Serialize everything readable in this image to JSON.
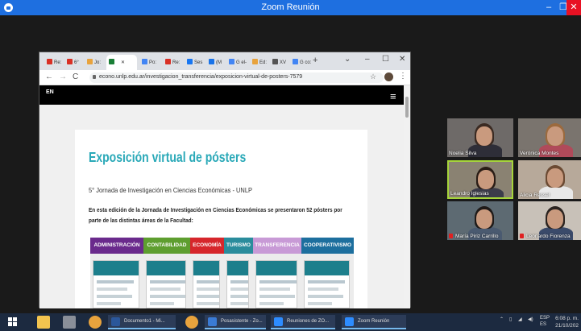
{
  "window": {
    "title": "Zoom Reunión",
    "min": "–",
    "max": "❐",
    "close": "✕"
  },
  "browser": {
    "tabs": [
      {
        "label": "Re:",
        "color": "#d93025"
      },
      {
        "label": "6°",
        "color": "#d93025"
      },
      {
        "label": "Jo:",
        "color": "#e8a33d"
      },
      {
        "label": "",
        "color": "#1a7f37",
        "active": true
      },
      {
        "label": "Po:",
        "color": "#4285f4"
      },
      {
        "label": "Re:",
        "color": "#d93025"
      },
      {
        "label": "Ses",
        "color": "#1877f2"
      },
      {
        "label": "(M",
        "color": "#1a73e8"
      },
      {
        "label": "G el-",
        "color": "#4285f4"
      },
      {
        "label": "Ed:",
        "color": "#e8a33d"
      },
      {
        "label": "XV",
        "color": "#555555"
      },
      {
        "label": "G co:",
        "color": "#4285f4"
      }
    ],
    "active_close": "✕",
    "new_tab": "+",
    "url": "econo.unlp.edu.ar/investigacion_transferencia/exposicion-virtual-de-posters-7579",
    "back": "←",
    "forward": "→",
    "reload": "C",
    "bookmark": "☆",
    "menu": "⋮",
    "collapse": "⌄",
    "min": "–",
    "max": "☐",
    "close": "✕"
  },
  "site": {
    "logo": "EN",
    "menu": "≡",
    "title": "Exposición virtual de pósters",
    "subtitle": "5° Jornada de Investigación en Ciencias Económicas - UNLP",
    "body": "En esta edición de la Jornada de Investigación en Ciencias Económicas se presentaron 52 pósters por parte de las distintas áreas de la Facultad:",
    "categories": [
      {
        "label": "ADMINISTRACIÓN",
        "color": "#6a2a8c"
      },
      {
        "label": "CONTABILIDAD",
        "color": "#5e9e2f"
      },
      {
        "label": "ECONOMÍA",
        "color": "#d6262b"
      },
      {
        "label": "TURISMO",
        "color": "#2a8c9c"
      },
      {
        "label": "TRANSFERENCIA",
        "color": "#c89ad6"
      },
      {
        "label": "COOPERATIVISMO",
        "color": "#1d6f9e"
      }
    ]
  },
  "participants": [
    {
      "name": "Noelia Silva",
      "muted": false
    },
    {
      "name": "Verónica Montes",
      "muted": false
    },
    {
      "name": "Leandro Iglesias",
      "muted": false,
      "speaking": true
    },
    {
      "name": "Alicia Ressel",
      "muted": false
    },
    {
      "name": "María Piriz Carrillo",
      "muted": true
    },
    {
      "name": "Leonardo Fiorenza",
      "muted": true
    }
  ],
  "taskbar": {
    "apps": [
      {
        "label": "Documento1 - Mi...",
        "color": "#2b579a"
      },
      {
        "label": "Posasistente - Zo...",
        "color": "#3a7bd5"
      },
      {
        "label": "Reuniones de ZO...",
        "color": "#2d8cff"
      },
      {
        "label": "Zoom Reunión",
        "color": "#2d8cff"
      }
    ],
    "lang1": "ESP",
    "lang2": "ES",
    "time": "6:08 p. m.",
    "date": "21/10/202"
  }
}
